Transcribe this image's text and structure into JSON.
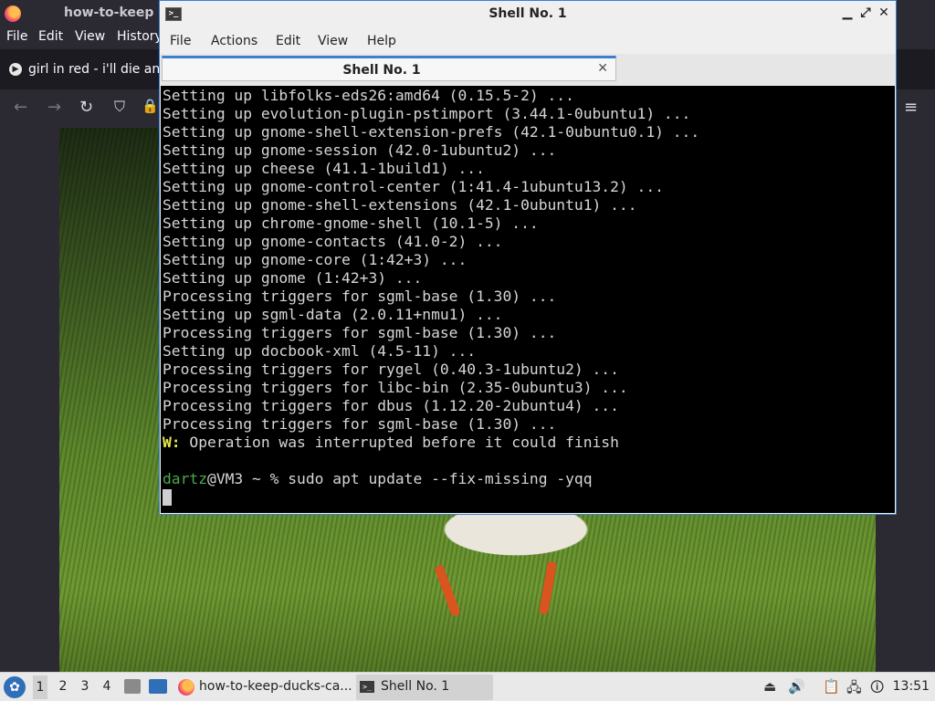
{
  "browser": {
    "title": "how-to-keep",
    "menu": [
      "File",
      "Edit",
      "View",
      "History"
    ],
    "tab_label": "girl in red - i'll die any",
    "tab_icon": "play-icon"
  },
  "terminal": {
    "window_title": "Shell No. 1",
    "menu": [
      "File",
      "Actions",
      "Edit",
      "View",
      "Help"
    ],
    "tab_label": "Shell No. 1",
    "close_glyph": "✕",
    "minimize_glyph": "▁",
    "maximize_glyph": "⤢",
    "output_lines": [
      "Setting up libfolks-eds26:amd64 (0.15.5-2) ...",
      "Setting up evolution-plugin-pstimport (3.44.1-0ubuntu1) ...",
      "Setting up gnome-shell-extension-prefs (42.1-0ubuntu0.1) ...",
      "Setting up gnome-session (42.0-1ubuntu2) ...",
      "Setting up cheese (41.1-1build1) ...",
      "Setting up gnome-control-center (1:41.4-1ubuntu13.2) ...",
      "Setting up gnome-shell-extensions (42.1-0ubuntu1) ...",
      "Setting up chrome-gnome-shell (10.1-5) ...",
      "Setting up gnome-contacts (41.0-2) ...",
      "Setting up gnome-core (1:42+3) ...",
      "Setting up gnome (1:42+3) ...",
      "Processing triggers for sgml-base (1.30) ...",
      "Setting up sgml-data (2.0.11+nmu1) ...",
      "Processing triggers for sgml-base (1.30) ...",
      "Setting up docbook-xml (4.5-11) ...",
      "Processing triggers for rygel (0.40.3-1ubuntu2) ...",
      "Processing triggers for libc-bin (2.35-0ubuntu3) ...",
      "Processing triggers for dbus (1.12.20-2ubuntu4) ...",
      "Processing triggers for sgml-base (1.30) ..."
    ],
    "warning_prefix": "W:",
    "warning_text": " Operation was interrupted before it could finish",
    "prompt_user": "dartz",
    "prompt_rest": "@VM3 ~ % ",
    "command": "sudo apt update --fix-missing -yqq"
  },
  "taskbar": {
    "workspaces": [
      "1",
      "2",
      "3",
      "4"
    ],
    "active_workspace": "1",
    "tasks": [
      {
        "label": "how-to-keep-ducks-ca...",
        "icon": "firefox-icon"
      },
      {
        "label": "Shell No. 1",
        "icon": "terminal-icon"
      }
    ],
    "clock": "13:51"
  }
}
